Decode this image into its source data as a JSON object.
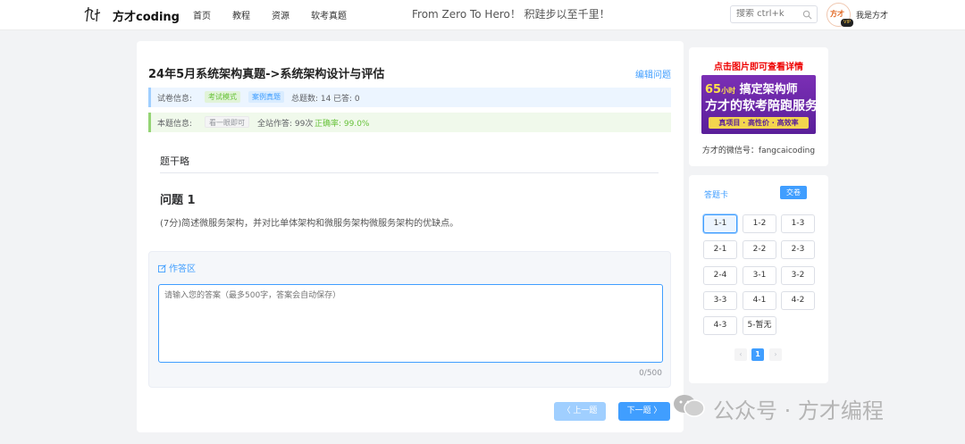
{
  "header": {
    "logo_text": "方才coding",
    "nav": [
      "首页",
      "教程",
      "资源",
      "软考真题"
    ],
    "slogan": "From Zero To Hero！ 积跬步以至千里！",
    "search_placeholder": "搜索 ctrl+k",
    "avatar_text": "方才",
    "vip": "VIP",
    "username": "我是方才"
  },
  "question": {
    "title": "24年5月系统架构真题->系统架构设计与评估",
    "edit_label": "编辑问题",
    "paper_label": "试卷信息:",
    "mode_tag": "考试模式",
    "type_tag": "案例真题",
    "total": "总题数: 14",
    "answered": "已答: 0",
    "item_label": "本题信息:",
    "difficulty_tag": "看一眼即可",
    "site_answers": "全站作答: 99次",
    "accuracy": "正确率: 99.0%",
    "stem_title": "题干略",
    "heading": "问题 1",
    "text": "(7分)简述微服务架构，并对比单体架构和微服务架构微服务架构的优缺点。"
  },
  "answer": {
    "header": "作答区",
    "placeholder": "请输入您的答案（最多500字，答案会自动保存）",
    "count": "0/500",
    "prev_label": "〈 上一题",
    "next_label": "下一题 〉"
  },
  "ad": {
    "title": "点击图片即可查看详情",
    "line1_num": "65",
    "line1_unit": "小时",
    "line1_rest": "搞定架构师",
    "line2": "方才的软考陪跑服务",
    "line3": "真项目 · 高性价 · 高效率",
    "wechat": "方才的微信号：fangcaicoding"
  },
  "sheet": {
    "title": "答题卡",
    "submit_label": "交卷",
    "items": [
      "1-1",
      "1-2",
      "1-3",
      "2-1",
      "2-2",
      "2-3",
      "2-4",
      "3-1",
      "3-2",
      "3-3",
      "4-1",
      "4-2",
      "4-3",
      "5-暂无"
    ],
    "active": "1-1",
    "page": "1",
    "page_prev": "‹",
    "page_next": "›"
  },
  "watermark": {
    "text": "公众号 · 方才编程"
  },
  "colors": {
    "primary": "#409eff",
    "success": "#67c23a",
    "ad_red": "#ee0000"
  }
}
